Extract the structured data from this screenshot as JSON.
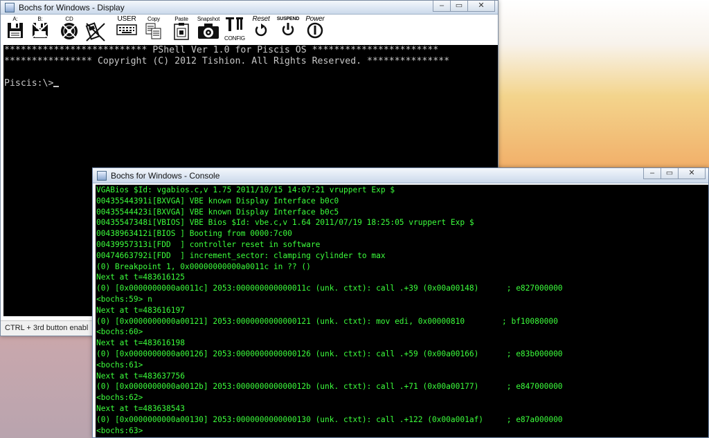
{
  "display_window": {
    "title": "Bochs for Windows - Display",
    "toolbar": [
      {
        "label": "A:",
        "icon": "floppy-a-icon"
      },
      {
        "label": "B:",
        "icon": "floppy-b-icon"
      },
      {
        "label": "CD",
        "icon": "cdrom-icon"
      },
      {
        "label": "",
        "icon": "usb-icon"
      },
      {
        "label": "USER",
        "icon": "keyboard-icon"
      },
      {
        "label": "Copy",
        "icon": "copy-icon"
      },
      {
        "label": "Paste",
        "icon": "paste-icon"
      },
      {
        "label": "Snapshot",
        "icon": "camera-icon"
      },
      {
        "label": "CONFIG",
        "icon": "config-icon"
      },
      {
        "label": "Reset",
        "icon": "reset-icon"
      },
      {
        "label": "SUSPEND",
        "icon": "suspend-icon"
      },
      {
        "label": "Power",
        "icon": "power-icon"
      }
    ],
    "screen_lines": [
      "************************** PShell Ver 1.0 for Piscis OS ***********************",
      "**************** Copyright (C) 2012 Tishion. All Rights Reserved. ***************",
      "",
      "Piscis:\\>"
    ],
    "status_text": "CTRL + 3rd button enabl",
    "colors": {
      "screen_text": "#c8c8c8",
      "screen_bg": "#000000"
    }
  },
  "console_window": {
    "title": "Bochs for Windows - Console",
    "lines": [
      "VGABios $Id: vgabios.c,v 1.75 2011/10/15 14:07:21 vruppert Exp $",
      "00435544391i[BXVGA] VBE known Display Interface b0c0",
      "00435544423i[BXVGA] VBE known Display Interface b0c5",
      "00435547348i[VBIOS] VBE Bios $Id: vbe.c,v 1.64 2011/07/19 18:25:05 vruppert Exp $",
      "00438963412i[BIOS ] Booting from 0000:7c00",
      "00439957313i[FDD  ] controller reset in software",
      "00474663792i[FDD  ] increment_sector: clamping cylinder to max",
      "(0) Breakpoint 1, 0x00000000000a0011c in ?? ()",
      "Next at t=483616125",
      "(0) [0x0000000000a0011c] 2053:000000000000011c (unk. ctxt): call .+39 (0x00a00148)      ; e827000000",
      "<bochs:59> n",
      "Next at t=483616197",
      "(0) [0x0000000000a00121] 2053:0000000000000121 (unk. ctxt): mov edi, 0x00000810        ; bf10080000",
      "<bochs:60>",
      "Next at t=483616198",
      "(0) [0x0000000000a00126] 2053:0000000000000126 (unk. ctxt): call .+59 (0x00a00166)      ; e83b000000",
      "<bochs:61>",
      "Next at t=483637756",
      "(0) [0x0000000000a0012b] 2053:000000000000012b (unk. ctxt): call .+71 (0x00a00177)      ; e847000000",
      "<bochs:62>",
      "Next at t=483638543",
      "(0) [0x0000000000a00130] 2053:0000000000000130 (unk. ctxt): call .+122 (0x00a001af)     ; e87a000000",
      "<bochs:63>"
    ],
    "colors": {
      "text": "#3cff3c",
      "bg": "#000000"
    }
  },
  "window_controls": {
    "minimize": "–",
    "maximize": "▭",
    "close": "✕"
  }
}
